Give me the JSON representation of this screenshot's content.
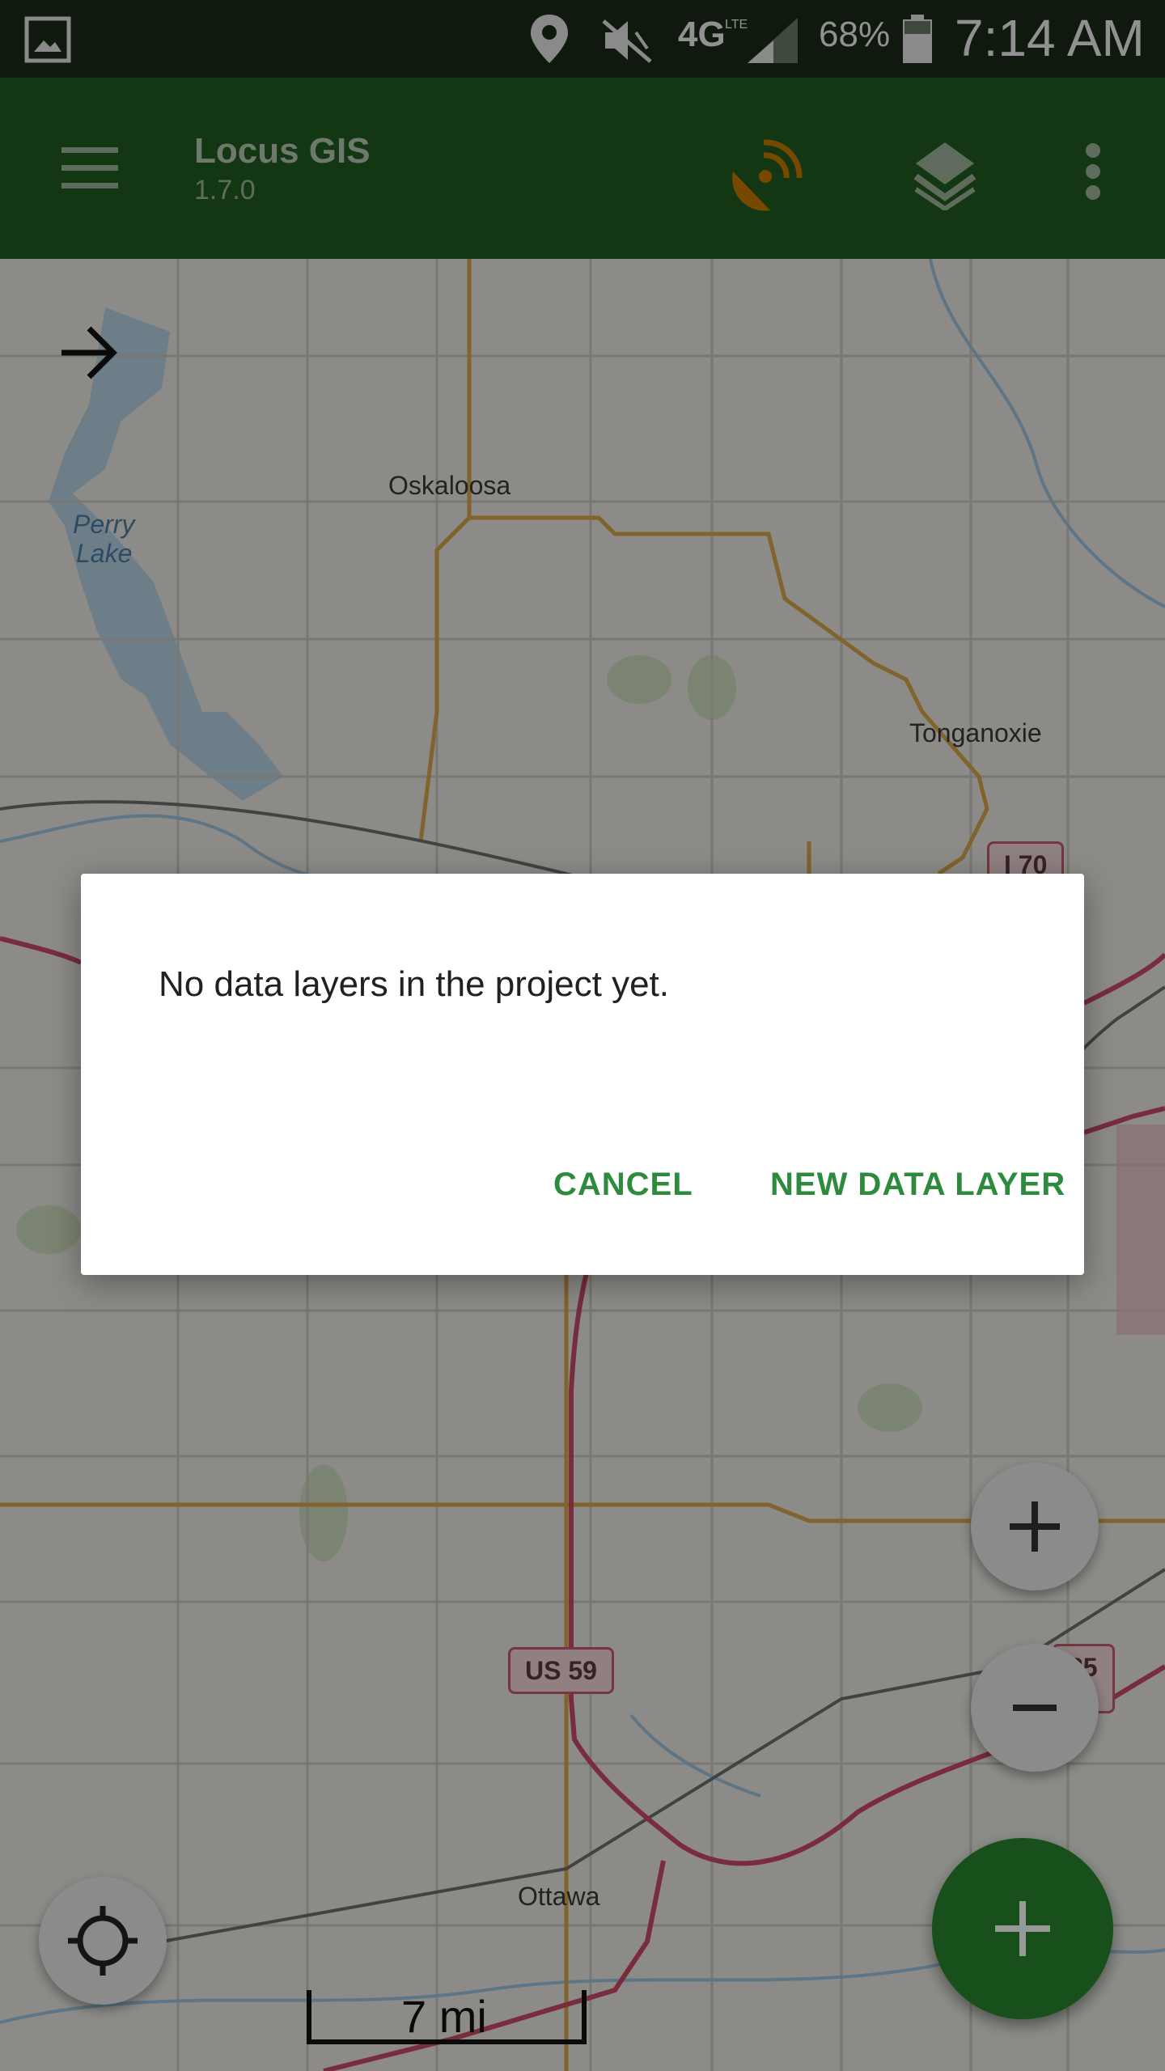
{
  "status_bar": {
    "network": "4G",
    "network_sub": "LTE",
    "battery": "68%",
    "time": "7:14 AM"
  },
  "app_bar": {
    "title": "Locus GIS",
    "version": "1.7.0",
    "icons": [
      "menu-icon",
      "gps-satellite-icon",
      "layers-icon",
      "more-vert-icon"
    ]
  },
  "map": {
    "labels": {
      "oskaloosa": "Oskaloosa",
      "perry_lake_line1": "Perry",
      "perry_lake_line2": "Lake",
      "tonganoxie": "Tonganoxie",
      "ottawa": "Ottawa"
    },
    "shields": {
      "i70": "I 70",
      "us59": "US 59",
      "partial": "35"
    },
    "scale": "7 mi"
  },
  "dialog": {
    "message": "No data layers in the project yet.",
    "cancel_label": "CANCEL",
    "confirm_label": "NEW DATA LAYER"
  },
  "colors": {
    "app_bar": "#1f5d1f",
    "status_bar": "#1a2b16",
    "accent": "#2e8b3e",
    "fab": "#27852d",
    "gps_icon": "#c77a00"
  }
}
